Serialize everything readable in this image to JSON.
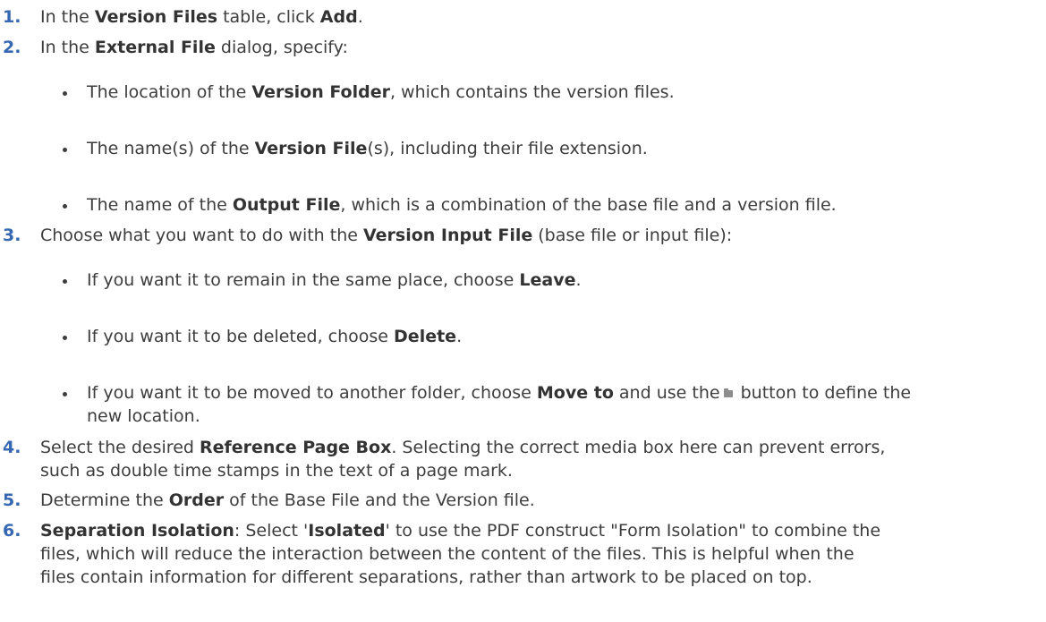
{
  "steps": [
    {
      "num": "1.",
      "segments": [
        {
          "t": "In the ",
          "b": false
        },
        {
          "t": "Version Files",
          "b": true
        },
        {
          "t": " table, click ",
          "b": false
        },
        {
          "t": "Add",
          "b": true
        },
        {
          "t": ".",
          "b": false
        }
      ]
    },
    {
      "num": "2.",
      "segments": [
        {
          "t": "In the ",
          "b": false
        },
        {
          "t": "External File",
          "b": true
        },
        {
          "t": " dialog, specify:",
          "b": false
        }
      ]
    },
    {
      "num": "3.",
      "segments": [
        {
          "t": "Choose what you want to do with the ",
          "b": false
        },
        {
          "t": "Version Input File",
          "b": true
        },
        {
          "t": " (base file or input file):",
          "b": false
        }
      ]
    },
    {
      "num": "4.",
      "lines": [
        [
          {
            "t": "Select the desired ",
            "b": false
          },
          {
            "t": "Reference Page Box",
            "b": true
          },
          {
            "t": ". Selecting the correct media box here can prevent errors,",
            "b": false
          }
        ],
        [
          {
            "t": "such as double time stamps in the text of a page mark.",
            "b": false
          }
        ]
      ]
    },
    {
      "num": "5.",
      "segments": [
        {
          "t": "Determine the ",
          "b": false
        },
        {
          "t": "Order",
          "b": true
        },
        {
          "t": " of the Base File and the Version file.",
          "b": false
        }
      ]
    },
    {
      "num": "6.",
      "lines": [
        [
          {
            "t": "Separation Isolation",
            "b": true
          },
          {
            "t": ": Select '",
            "b": false
          },
          {
            "t": "Isolated",
            "b": true
          },
          {
            "t": "' to use the PDF construct \"Form Isolation\" to combine the",
            "b": false
          }
        ],
        [
          {
            "t": "files, which will reduce the interaction between the content of the files. This is helpful when the",
            "b": false
          }
        ],
        [
          {
            "t": "files contain information for different separations, rather than artwork to be placed on top.",
            "b": false
          }
        ]
      ]
    }
  ],
  "step2_bullets": [
    [
      {
        "t": "The location of the ",
        "b": false
      },
      {
        "t": "Version Folder",
        "b": true
      },
      {
        "t": ", which contains the version files.",
        "b": false
      }
    ],
    [
      {
        "t": "The name(s) of the ",
        "b": false
      },
      {
        "t": "Version File",
        "b": true
      },
      {
        "t": "(s), including their file extension.",
        "b": false
      }
    ],
    [
      {
        "t": "The name of the ",
        "b": false
      },
      {
        "t": "Output File",
        "b": true
      },
      {
        "t": ", which is a combination of the base file and a version file.",
        "b": false
      }
    ]
  ],
  "step3_bullets": [
    [
      {
        "t": "If you want it to remain in the same place, choose ",
        "b": false
      },
      {
        "t": "Leave",
        "b": true
      },
      {
        "t": ".",
        "b": false
      }
    ],
    [
      {
        "t": "If you want it to be deleted, choose ",
        "b": false
      },
      {
        "t": "Delete",
        "b": true
      },
      {
        "t": ".",
        "b": false
      }
    ]
  ],
  "step3_bullet3": {
    "before": "If you want it to be moved to another folder, choose ",
    "bold": "Move to",
    "middle": " and use the",
    "after_line1": " button to define the",
    "line2": "new location.",
    "icon": "folder-icon"
  }
}
